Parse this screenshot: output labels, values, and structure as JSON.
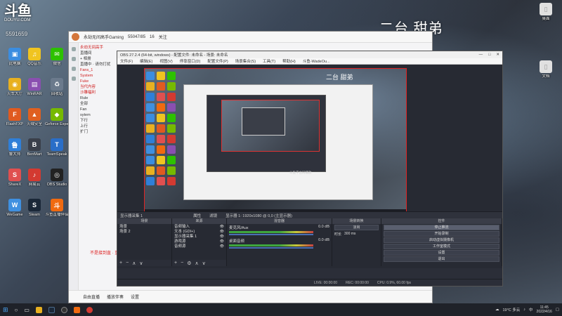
{
  "overlay": {
    "title": "二台 甜弟",
    "preview_title": "二台 甜弟"
  },
  "douyu": {
    "logo_text": "斗鱼",
    "logo_sub": "DOUYU.COM",
    "room_id": "5591659"
  },
  "desktop": {
    "left_icons": [
      {
        "label": "此电脑",
        "color": "#3b8de0",
        "glyph": "▣"
      },
      {
        "label": "QQ音乐",
        "color": "#f0c420",
        "glyph": "♫"
      },
      {
        "label": "微信",
        "color": "#2dc100",
        "glyph": "✉"
      },
      {
        "label": "火车大厅",
        "color": "#e8b020",
        "glyph": "◉"
      },
      {
        "label": "WinRAR",
        "color": "#8a4fb0",
        "glyph": "▤"
      },
      {
        "label": "回收站",
        "color": "#6b7a8c",
        "glyph": "♻"
      },
      {
        "label": "FlashFXP",
        "color": "#e05a20",
        "glyph": "F"
      },
      {
        "label": "火绒安全",
        "color": "#e06020",
        "glyph": "▲"
      },
      {
        "label": "Geforce Experience",
        "color": "#76b900",
        "glyph": "◆"
      },
      {
        "label": "鲁大师",
        "color": "#2f7fd8",
        "glyph": "鲁"
      },
      {
        "label": "BenMart",
        "color": "#3a3f4a",
        "glyph": "B"
      },
      {
        "label": "TeamSpeak",
        "color": "#2a6ec8",
        "glyph": "T"
      },
      {
        "label": "ShareX",
        "color": "#e05050",
        "glyph": "S"
      },
      {
        "label": "网易云",
        "color": "#d33a31",
        "glyph": "♪"
      },
      {
        "label": "OBS Studio",
        "color": "#222",
        "glyph": "◎"
      },
      {
        "label": "WeGame",
        "color": "#3f90e0",
        "glyph": "W"
      },
      {
        "label": "Steam",
        "color": "#1b2838",
        "glyph": "S"
      },
      {
        "label": "斗鱼直播伴侣",
        "color": "#f06a10",
        "glyph": "斗"
      }
    ],
    "right_icons": [
      {
        "label": "桌面",
        "color": "#e0e0e0",
        "glyph": "▯"
      },
      {
        "label": "文档",
        "color": "#e0e0e0",
        "glyph": "▯"
      }
    ]
  },
  "client": {
    "title": "永劫无间高手Gaming",
    "fans": "55047/85",
    "level": "16",
    "follow": "关注",
    "tree": [
      "永劫无间高手",
      "直播间",
      "+ 相册",
      "直播中 · 请勿打扰",
      "  Fans_1",
      "  System",
      "  Fuke",
      "  当代内容",
      "  沙雕福利",
      "Rule",
      "全部",
      "Fan",
      "sytem",
      "下行",
      "上行",
      "扩门"
    ],
    "warning": "不是接到直 · 重新配置",
    "bottom": [
      "自由直播",
      "播放伴奏",
      "设置"
    ]
  },
  "obs": {
    "title": "OBS 27.2.4 (64-bit, windows) - 配置文件: 未命名 - 场景: 未命名",
    "window_btns": [
      "—",
      "□",
      "✕"
    ],
    "menu": [
      "文件(F)",
      "编辑(E)",
      "视图(V)",
      "停靠窗口(D)",
      "配置文件(P)",
      "场景集合(S)",
      "工具(T)",
      "帮助(H)",
      "斗鱼-WadeOu..."
    ],
    "preview_caption": "斗鱼平台同播放",
    "scene_bar": "显示器采集 1",
    "scene_props": [
      "属性",
      "滤镜",
      "显示器 1: 1920x1080 @ 0,0 (主显示器)"
    ],
    "docks": {
      "scenes": {
        "header": "场景",
        "items": [
          "场景",
          "场景 2"
        ]
      },
      "sources": {
        "header": "来源",
        "items": [
          "音频输入",
          "文本 (GDI+)",
          "显示器采集 1",
          "游戏源",
          "音频源"
        ]
      },
      "mixer": {
        "header": "混音器",
        "items": [
          {
            "name": "麦克风/Aux",
            "db": "0.0 dB"
          },
          {
            "name": "桌面音频",
            "db": "0.0 dB"
          }
        ]
      },
      "transitions": {
        "header": "场景转换",
        "fade": "淡出",
        "duration_label": "时长",
        "duration": "300 ms"
      },
      "controls": {
        "header": "控件",
        "buttons": [
          "停止推流",
          "开始录制",
          "启动虚拟摄像机",
          "工作室模式",
          "设置",
          "退出"
        ]
      }
    },
    "status": [
      "LIVE: 00:00:00",
      "REC: 00:00:00",
      "CPU: 0.9%, 60.00 fps"
    ]
  },
  "taskbar": {
    "weather": "19°C 多云",
    "time": "11:45",
    "date": "2022/4/16",
    "lang": "中"
  }
}
